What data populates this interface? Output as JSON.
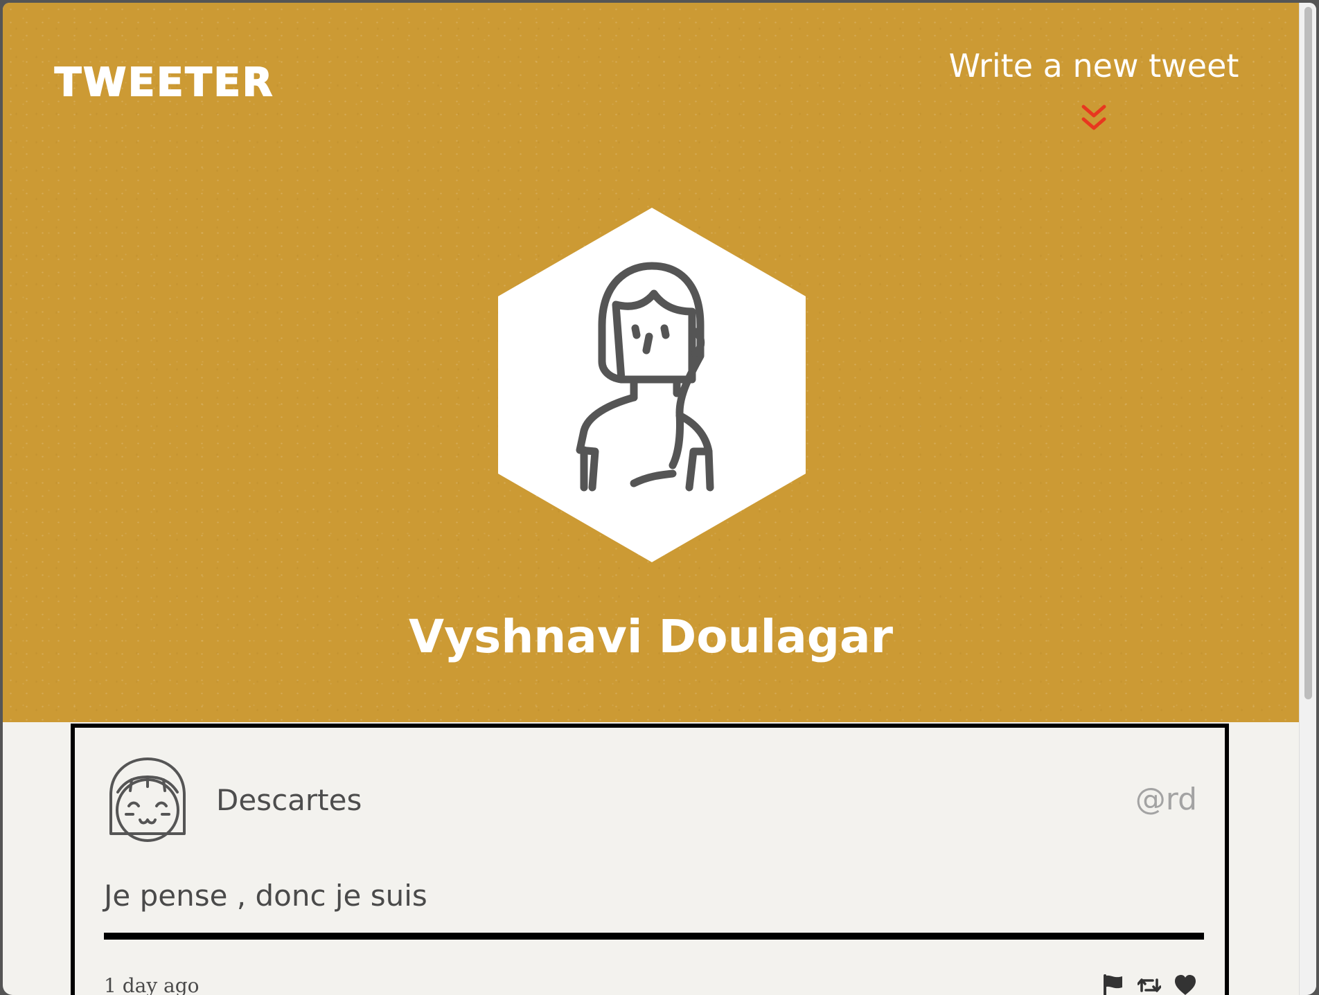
{
  "header": {
    "logo": "TWEETER",
    "compose_label": "Write a new tweet",
    "compose_icon": "chevron-double-down-icon",
    "accent_color": "#e8371f",
    "background_color": "#cc9a34"
  },
  "profile": {
    "name": "Vyshnavi Doulagar",
    "avatar_icon": "woman-avatar-icon"
  },
  "tweets": [
    {
      "user_name": "Descartes",
      "handle": "@rd",
      "avatar_icon": "girl-avatar-icon",
      "text": "Je pense , donc je suis",
      "time": "1 day ago",
      "actions": [
        "flag-icon",
        "retweet-icon",
        "heart-icon"
      ]
    }
  ]
}
